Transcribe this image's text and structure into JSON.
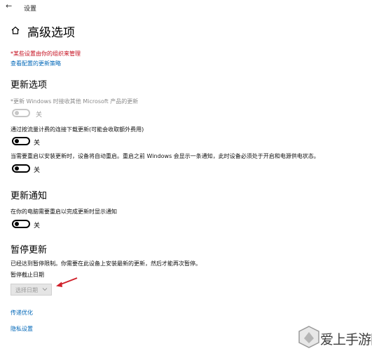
{
  "window": {
    "title": "设置"
  },
  "page": {
    "title": "高级选项"
  },
  "notice": {
    "managed": "*某些设置由你的组织来管理",
    "view_policies": "查看配置的更新策略"
  },
  "update_options": {
    "heading": "更新选项",
    "microsoft_updates": {
      "label": "*更新 Windows 时接收其他 Microsoft 产品的更新",
      "state": "关"
    },
    "metered": {
      "label": "通过按流量计费的连接下载更新(可能会收取额外费用)",
      "state": "关"
    },
    "restart_asap": {
      "label": "当需要重启以安装更新时，设备将自动重启。重启之前 Windows 会显示一条通知，此时设备必须处于开启和电源供电状态。",
      "state": "关"
    }
  },
  "update_notifications": {
    "heading": "更新通知",
    "restart_notify": {
      "label": "在你的电脑需要重启以完成更新时显示通知",
      "state": "关"
    }
  },
  "pause_updates": {
    "heading": "暂停更新",
    "description": "已经达到暂停限制。你需要在此设备上安装最新的更新，然后才能再次暂停。",
    "until_label": "暂停截止日期",
    "select_placeholder": "选择日期"
  },
  "links": {
    "delivery_optimization": "传递优化",
    "privacy_settings": "隐私设置"
  },
  "watermark": {
    "text": "爱上手游网"
  },
  "colors": {
    "link": "#0067b8",
    "warning": "#c50f1f",
    "annotation_arrow": "#d0202a"
  }
}
